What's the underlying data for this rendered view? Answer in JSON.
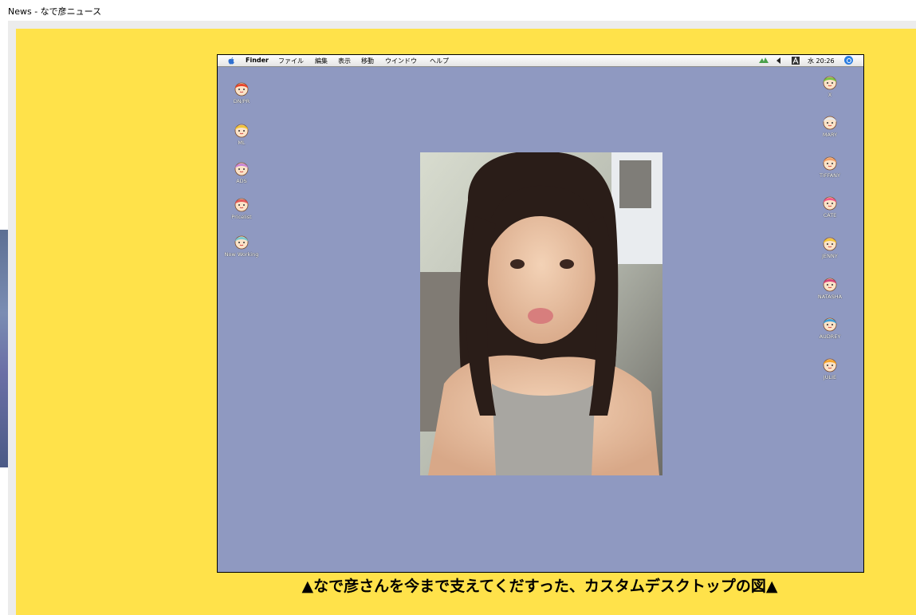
{
  "page": {
    "title": "News - なで彦ニュース"
  },
  "menubar": {
    "items": [
      {
        "id": "finder",
        "label": "Finder"
      },
      {
        "id": "file",
        "label": "ファイル"
      },
      {
        "id": "edit",
        "label": "編集"
      },
      {
        "id": "view",
        "label": "表示"
      },
      {
        "id": "go",
        "label": "移動"
      },
      {
        "id": "window",
        "label": "ウインドウ"
      },
      {
        "id": "help",
        "label": "ヘルプ"
      }
    ],
    "clock": "水 20:26"
  },
  "left_icons": [
    {
      "label": "DN/PR",
      "color": "#e8442a"
    },
    {
      "label": "ML",
      "color": "#f0c338"
    },
    {
      "label": "ADS",
      "color": "#c985d6"
    },
    {
      "label": "Pricelist",
      "color": "#e45858"
    },
    {
      "label": "Now Working",
      "color": "#7dc9cf"
    }
  ],
  "right_icons": [
    {
      "label": "X",
      "color": "#7ac043"
    },
    {
      "label": "MARY",
      "color": "#e8e8e8"
    },
    {
      "label": "TIFFANY",
      "color": "#f1a169"
    },
    {
      "label": "CATE",
      "color": "#f05a87"
    },
    {
      "label": "JENNY",
      "color": "#f2c43a"
    },
    {
      "label": "NATASHA",
      "color": "#d6447a"
    },
    {
      "label": "AUDREY",
      "color": "#3fa0d8"
    },
    {
      "label": "JULIE",
      "color": "#f4a531"
    }
  ],
  "caption": "▲なで彦さんを今まで支えてくだすった、カスタムデスクトップの図▲",
  "colors": {
    "panel": "#ffe24a",
    "desktop": "#8f99c1"
  }
}
